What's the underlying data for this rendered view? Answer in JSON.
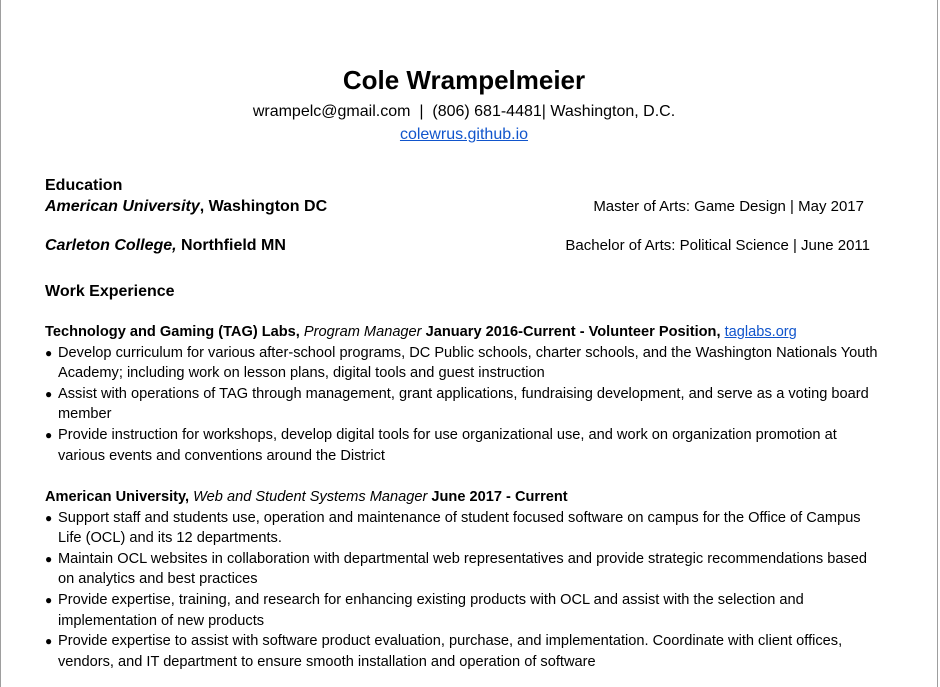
{
  "header": {
    "name": "Cole Wrampelmeier",
    "email": "wrampelc@gmail.com",
    "sep1": "  |  ",
    "phone": "(806) 681-4481",
    "sep2": "| ",
    "location": "Washington, D.C.",
    "website": "colewrus.github.io"
  },
  "education": {
    "title": "Education",
    "entries": [
      {
        "school": "American University",
        "place": ", Washington DC",
        "degree": "Master of Arts: Game Design | May 2017"
      },
      {
        "school": "Carleton College,",
        "place": " Northfield MN",
        "degree": "Bachelor of Arts: Political Science | June 2011"
      }
    ]
  },
  "work": {
    "title": "Work Experience",
    "jobs": [
      {
        "org": "Technology and Gaming (TAG) Labs,",
        "role": " Program Manager",
        "dates": " January 2016-Current - Volunteer Position,",
        "link": "taglabs.org",
        "bullets": [
          "Develop curriculum for various after-school programs, DC Public schools, charter schools, and the Washington Nationals Youth Academy; including work on lesson plans, digital tools and guest instruction",
          "Assist with operations of TAG through management, grant applications, fundraising development, and serve as a voting board member",
          "Provide instruction for workshops, develop digital tools for use organizational use, and work on organization promotion at various events and conventions around the District"
        ]
      },
      {
        "org": "American University,",
        "role": " Web and Student Systems Manager",
        "dates": " June 2017 - Current",
        "bullets": [
          "Support staff and students use, operation and maintenance of student focused software on campus for the Office of Campus Life (OCL) and its 12 departments.",
          "Maintain OCL websites in collaboration with departmental web representatives and provide strategic recommendations based on analytics and best practices",
          "Provide expertise, training, and research  for enhancing existing products with OCL and assist with the selection and implementation of new products",
          "Provide expertise to assist with software product evaluation, purchase, and implementation. Coordinate with client offices, vendors, and IT department to ensure smooth installation and operation of software"
        ]
      }
    ]
  }
}
